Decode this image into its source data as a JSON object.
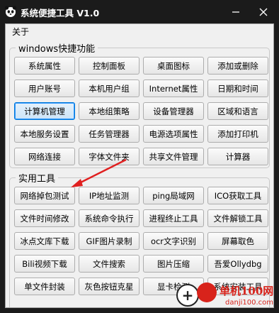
{
  "window": {
    "title": "系统便捷工具 V1.0"
  },
  "menu": {
    "about": "关于"
  },
  "groups": {
    "windows": {
      "legend": "windows快捷功能",
      "buttons": [
        "系统属性",
        "控制面板",
        "桌面图标",
        "添加或删除",
        "用户账号",
        "本机用户组",
        "Internet属性",
        "日期和时间",
        "计算机管理",
        "本地组策略",
        "设备管理器",
        "区域和语言",
        "本地服务设置",
        "任务管理器",
        "电源选项属性",
        "添加打印机",
        "网络连接",
        "字体文件夹",
        "共享文件管理",
        "计算器"
      ],
      "focused_button": "计算机管理"
    },
    "tools": {
      "legend": "实用工具",
      "buttons": [
        "网络掉包测试",
        "IP地址监测",
        "ping局域网",
        "ICO获取工具",
        "文件时间修改",
        "系统命令执行",
        "进程终止工具",
        "文件解锁工具",
        "冰点文库下载",
        "GIF图片录制",
        "ocr文字识别",
        "屏幕取色",
        "Bili视频下载",
        "文件搜索",
        "图片压缩",
        "吾爱Ollydbg",
        "单文件封装",
        "灰色按钮克星",
        "显卡检测",
        "系统安装工具"
      ]
    }
  },
  "watermark": {
    "text": "单机100网",
    "url": "danji100.com",
    "symbol": "+"
  },
  "colors": {
    "titlebar": "#1b1b1b",
    "client": "#f0f0f0",
    "arrow": "#e02020",
    "focus": "#0078d7",
    "watermark": "#d8231b"
  },
  "icons": {
    "app": "panda-icon",
    "minimize": "minimize-icon",
    "close": "close-icon",
    "annotation": "red-arrow-icon"
  }
}
